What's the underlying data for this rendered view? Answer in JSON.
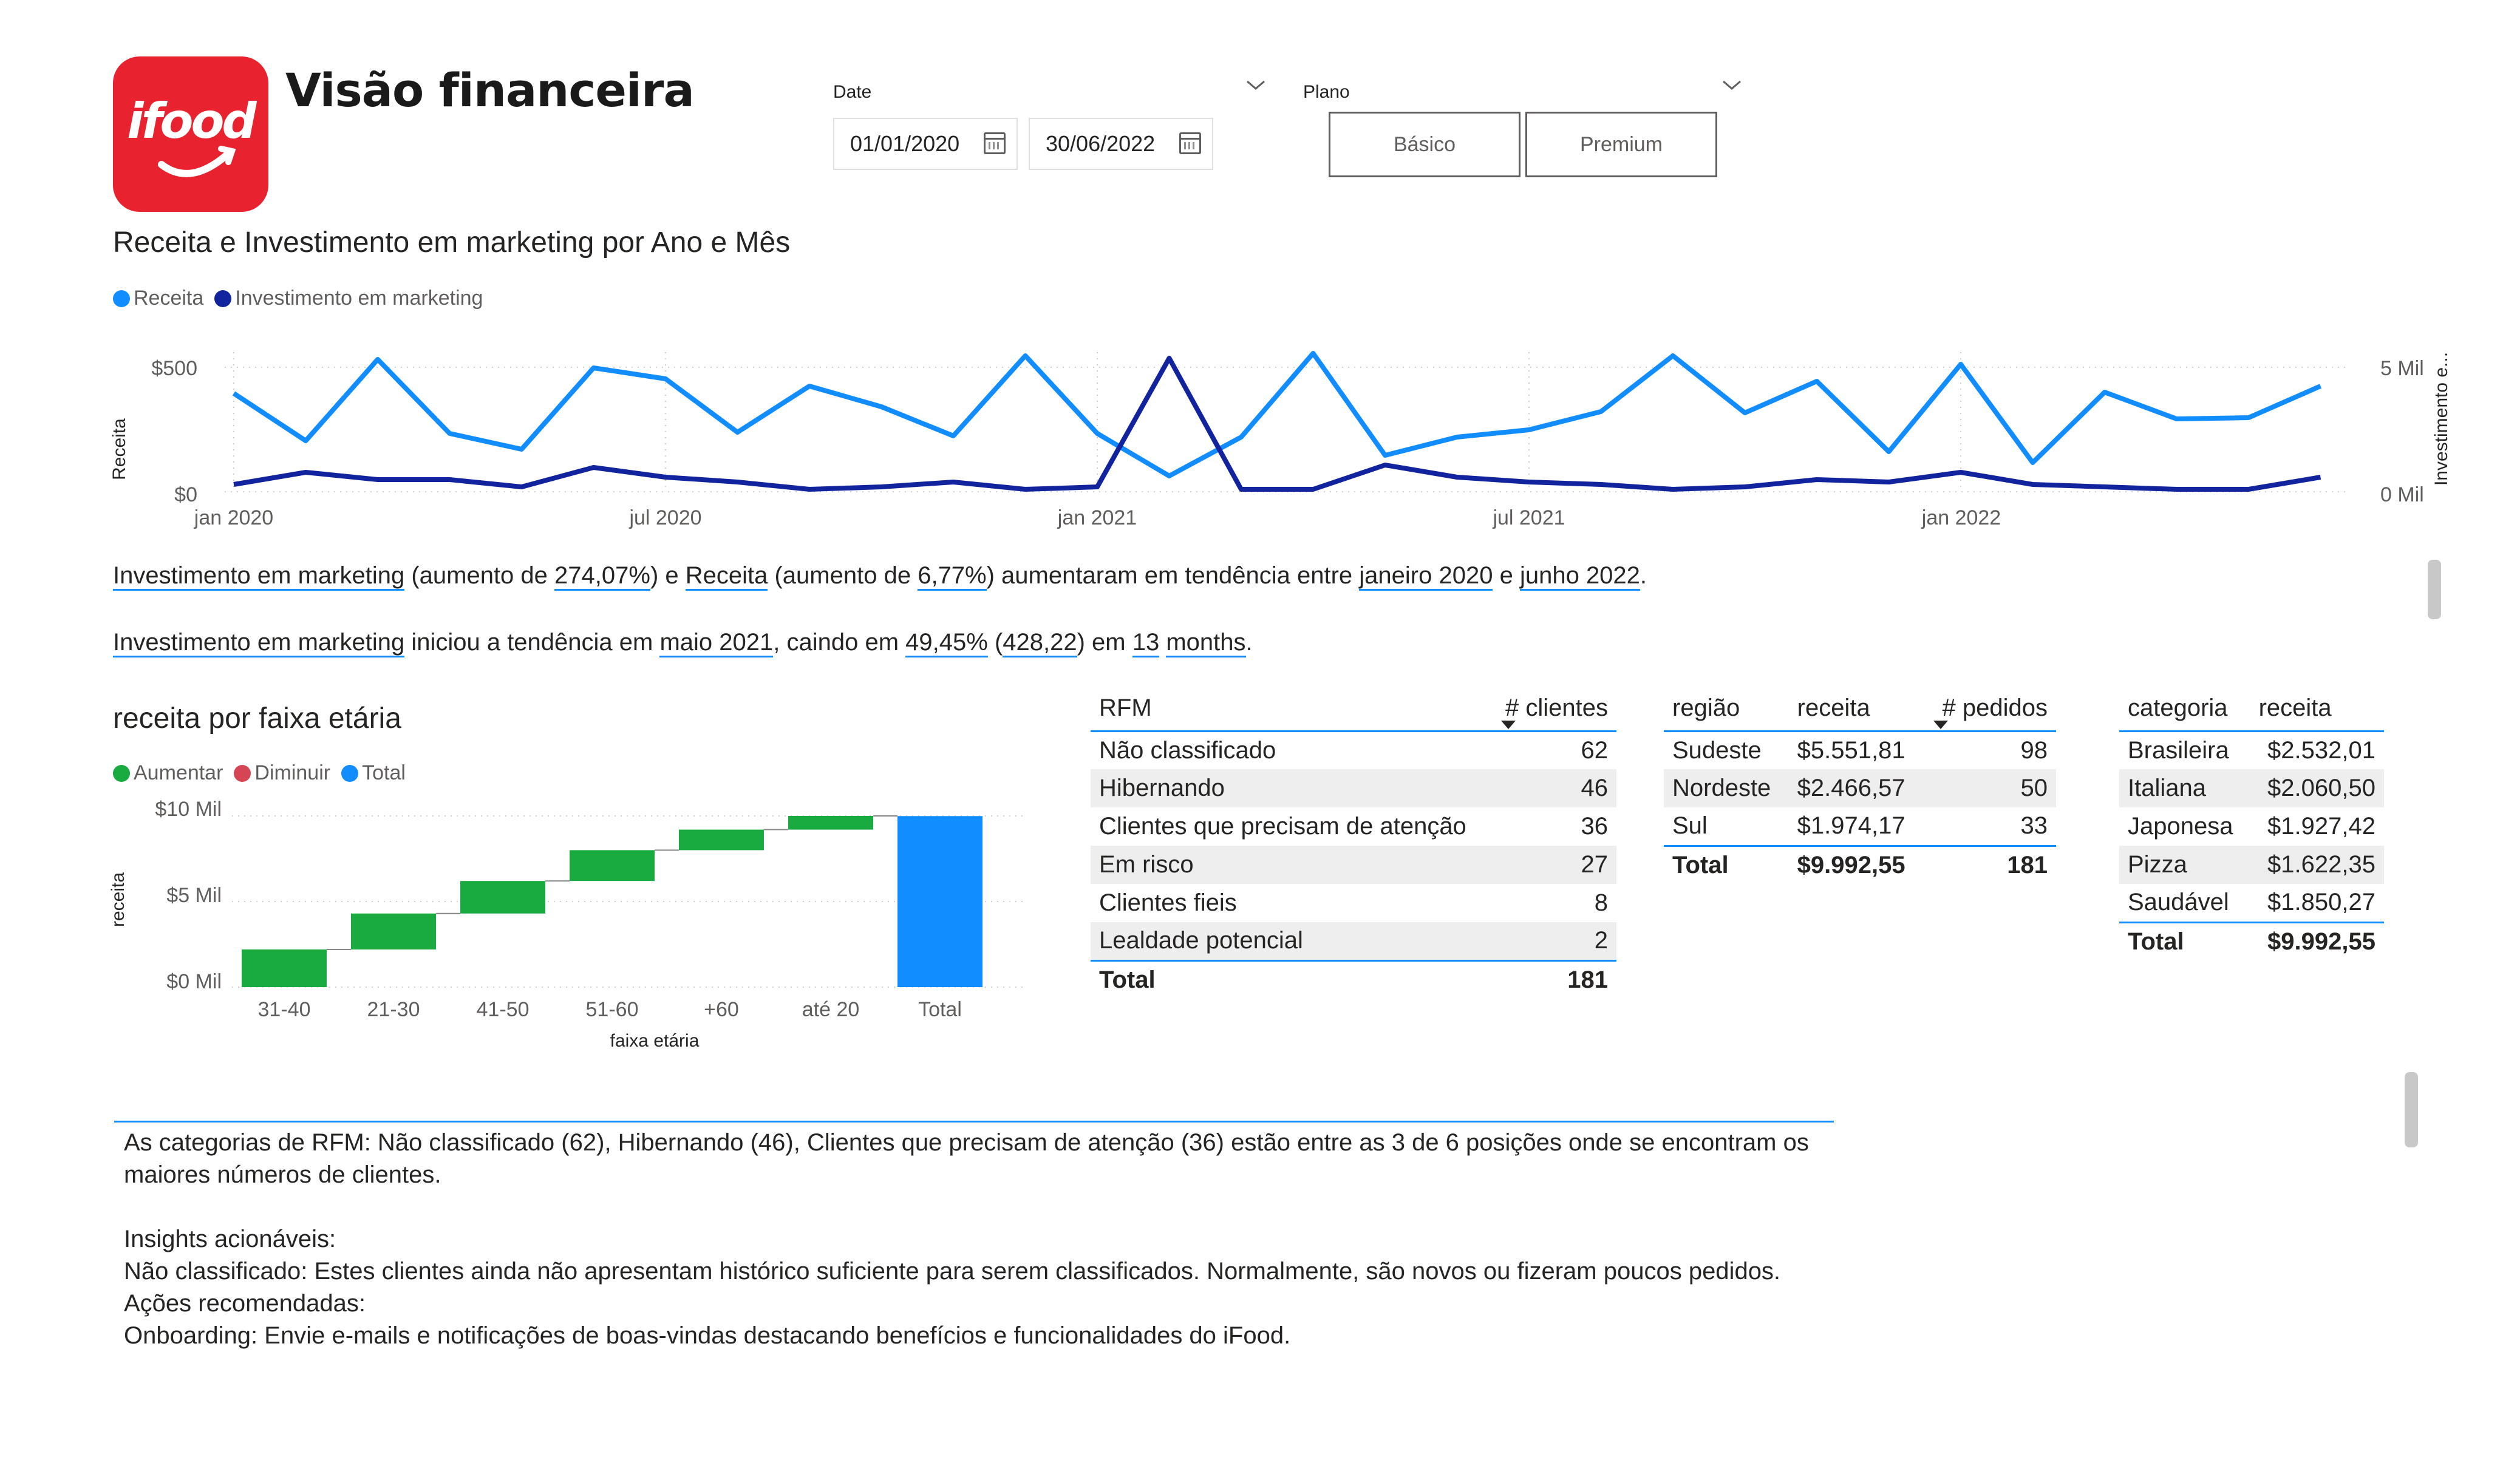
{
  "header": {
    "logo_text": "ifood",
    "title": "Visão financeira",
    "brand_color": "#e8222e"
  },
  "slicers": {
    "date": {
      "label": "Date",
      "start": "01/01/2020",
      "end": "30/06/2022"
    },
    "plano": {
      "label": "Plano",
      "options": [
        "Básico",
        "Premium"
      ]
    }
  },
  "line_chart": {
    "title": "Receita e Investimento em marketing por Ano e Mês",
    "legend": [
      {
        "name": "Receita",
        "color": "#118dff"
      },
      {
        "name": "Investimento em marketing",
        "color": "#12239e"
      }
    ],
    "y_left_label": "Receita",
    "y_right_label": "Investimento e...",
    "y_left_ticks": [
      "$500",
      "$0"
    ],
    "y_right_ticks": [
      "5 Mil",
      "0 Mil"
    ],
    "x_ticks": [
      "jan 2020",
      "jul 2020",
      "jan 2021",
      "jul 2021",
      "jan 2022"
    ]
  },
  "narrative": {
    "line1": {
      "a": "Investimento em marketing",
      "b": " (aumento de ",
      "c": "274,07%",
      "d": ") e ",
      "e": "Receita",
      "f": " (aumento de ",
      "g": "6,77%",
      "h": ") aumentaram em tendência entre ",
      "i": "janeiro 2020",
      "j": " e ",
      "k": "junho 2022",
      "l": "."
    },
    "line2": {
      "a": "Investimento em marketing",
      "b": " iniciou a tendência em ",
      "c": "maio 2021",
      "d": ", caindo em ",
      "e": "49,45%",
      "f": " (",
      "g": "428,22",
      "h": ") em ",
      "i": "13",
      "j": " ",
      "k": "months",
      "l": "."
    }
  },
  "waterfall": {
    "title": "receita por faixa etária",
    "legend": [
      {
        "name": "Aumentar",
        "color": "#1aab40"
      },
      {
        "name": "Diminuir",
        "color": "#d64554"
      },
      {
        "name": "Total",
        "color": "#118dff"
      }
    ],
    "ylabel": "receita",
    "xlabel": "faixa etária",
    "y_ticks": [
      "$10 Mil",
      "$5 Mil",
      "$0 Mil"
    ]
  },
  "rfm_table": {
    "headers": [
      "RFM",
      "# clientes"
    ],
    "rows": [
      [
        "Não classificado",
        "62"
      ],
      [
        "Hibernando",
        "46"
      ],
      [
        "Clientes que precisam de atenção",
        "36"
      ],
      [
        "Em risco",
        "27"
      ],
      [
        "Clientes fieis",
        "8"
      ],
      [
        "Lealdade potencial",
        "2"
      ]
    ],
    "total": [
      "Total",
      "181"
    ]
  },
  "region_table": {
    "headers": [
      "região",
      "receita",
      "# pedidos"
    ],
    "rows": [
      [
        "Sudeste",
        "$5.551,81",
        "98"
      ],
      [
        "Nordeste",
        "$2.466,57",
        "50"
      ],
      [
        "Sul",
        "$1.974,17",
        "33"
      ]
    ],
    "total": [
      "Total",
      "$9.992,55",
      "181"
    ]
  },
  "category_table": {
    "headers": [
      "categoria",
      "receita"
    ],
    "rows": [
      [
        "Brasileira",
        "$2.532,01"
      ],
      [
        "Italiana",
        "$2.060,50"
      ],
      [
        "Japonesa",
        "$1.927,42"
      ],
      [
        "Pizza",
        "$1.622,35"
      ],
      [
        "Saudável",
        "$1.850,27"
      ]
    ],
    "total": [
      "Total",
      "$9.992,55"
    ]
  },
  "insights": {
    "p1": "As categorias de RFM: Não classificado (62), Hibernando (46), Clientes que precisam de atenção (36) estão entre as 3 de 6 posições onde se encontram os maiores números de clientes.",
    "p2": "Insights acionáveis:",
    "p3": "Não classificado: Estes clientes ainda não apresentam histórico suficiente para serem classificados. Normalmente, são novos ou fizeram poucos pedidos.",
    "p4": "Ações recomendadas:",
    "p5": "Onboarding: Envie e-mails e notificações de boas-vindas destacando benefícios e funcionalidades do iFood."
  },
  "chart_data": [
    {
      "type": "line",
      "title": "Receita e Investimento em marketing por Ano e Mês",
      "x": [
        "2020-01",
        "2020-02",
        "2020-03",
        "2020-04",
        "2020-05",
        "2020-06",
        "2020-07",
        "2020-08",
        "2020-09",
        "2020-10",
        "2020-11",
        "2020-12",
        "2021-01",
        "2021-02",
        "2021-03",
        "2021-04",
        "2021-05",
        "2021-06",
        "2021-07",
        "2021-08",
        "2021-09",
        "2021-10",
        "2021-11",
        "2021-12",
        "2022-01",
        "2022-02",
        "2022-03",
        "2022-04",
        "2022-05",
        "2022-06"
      ],
      "series": [
        {
          "name": "Receita",
          "axis": "left",
          "values": [
            405,
            210,
            545,
            240,
            175,
            510,
            465,
            245,
            435,
            350,
            230,
            560,
            240,
            65,
            225,
            570,
            150,
            225,
            255,
            330,
            560,
            325,
            455,
            165,
            525,
            120,
            410,
            300,
            305,
            435
          ]
        },
        {
          "name": "Investimento em marketing",
          "axis": "right",
          "values": [
            0.3,
            0.8,
            0.5,
            0.5,
            0.2,
            1.0,
            0.6,
            0.4,
            0.1,
            0.2,
            0.4,
            0.1,
            0.2,
            5.5,
            0.1,
            0.1,
            1.1,
            0.6,
            0.4,
            0.3,
            0.1,
            0.2,
            0.5,
            0.4,
            0.8,
            0.3,
            0.2,
            0.1,
            0.1,
            0.6
          ]
        }
      ],
      "x_ticks": [
        "jan 2020",
        "jul 2020",
        "jan 2021",
        "jul 2021",
        "jan 2022"
      ],
      "ylabel": "Receita",
      "ylabel_right": "Investimento e...",
      "ylim": [
        0,
        600
      ],
      "ylim_right": [
        0,
        6.0
      ],
      "grid": true,
      "legend": "top-left"
    },
    {
      "type": "bar",
      "subtype": "waterfall",
      "title": "receita por faixa etária",
      "categories": [
        "31-40",
        "21-30",
        "41-50",
        "51-60",
        "+60",
        "até 20",
        "Total"
      ],
      "values": [
        2.2,
        2.1,
        1.9,
        1.8,
        1.2,
        0.8,
        9.99
      ],
      "xlabel": "faixa etária",
      "ylabel": "receita",
      "ylim": [
        0,
        10
      ],
      "legend": "top-left"
    }
  ]
}
